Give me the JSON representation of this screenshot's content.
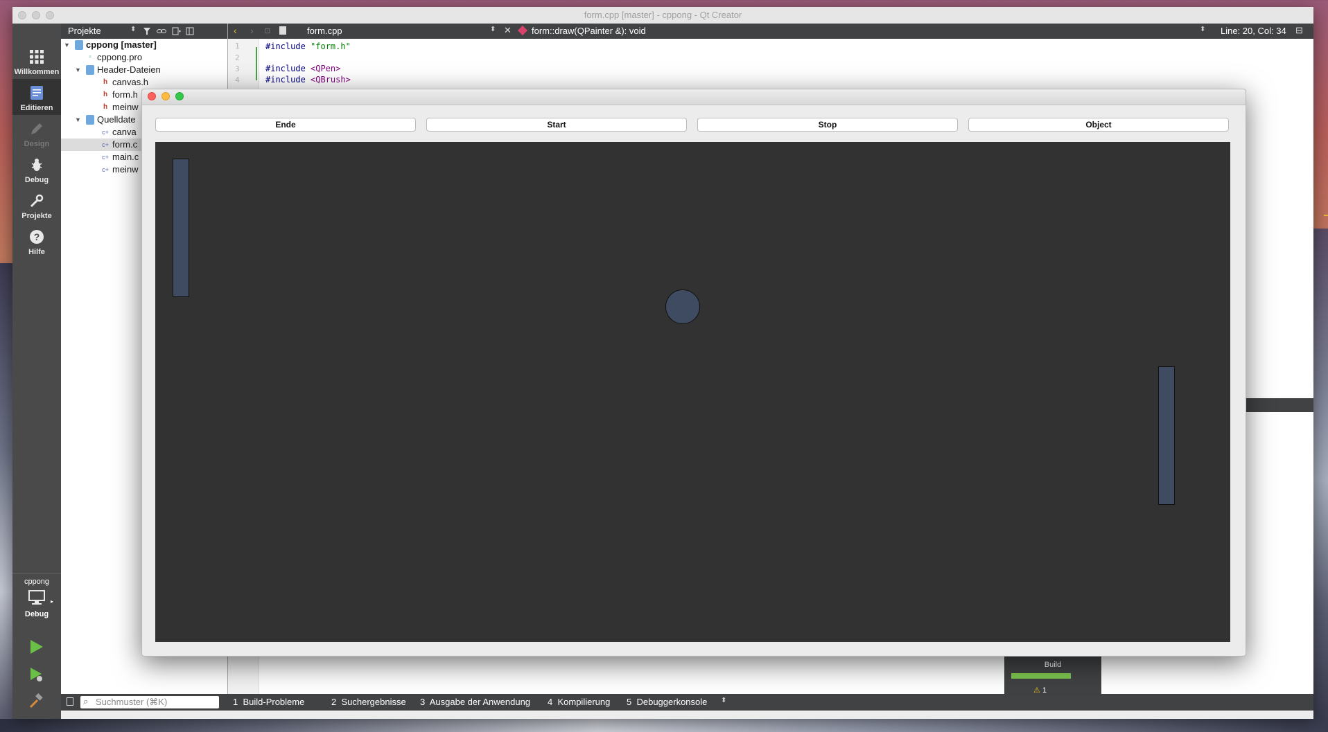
{
  "qt_window": {
    "title": "form.cpp [master] - cppong - Qt Creator"
  },
  "mode_bar": {
    "items": [
      {
        "label": "Willkommen",
        "icon": "grid-icon"
      },
      {
        "label": "Editieren",
        "icon": "edit-icon"
      },
      {
        "label": "Design",
        "icon": "pencil-icon"
      },
      {
        "label": "Debug",
        "icon": "bug-icon"
      },
      {
        "label": "Projekte",
        "icon": "wrench-icon"
      },
      {
        "label": "Hilfe",
        "icon": "help-icon"
      }
    ],
    "kit_project": "cppong",
    "kit_config": "Debug"
  },
  "project_panel": {
    "header": "Projekte",
    "tree": [
      {
        "label": "cppong [master]",
        "level": 0,
        "kind": "project"
      },
      {
        "label": "cppong.pro",
        "level": 1,
        "kind": "pro"
      },
      {
        "label": "Header-Dateien",
        "level": 1,
        "kind": "folder"
      },
      {
        "label": "canvas.h",
        "level": 2,
        "kind": "header"
      },
      {
        "label": "form.h",
        "level": 2,
        "kind": "header"
      },
      {
        "label": "meinw",
        "level": 2,
        "kind": "header"
      },
      {
        "label": "Quelldate",
        "level": 1,
        "kind": "folder"
      },
      {
        "label": "canva",
        "level": 2,
        "kind": "source"
      },
      {
        "label": "form.c",
        "level": 2,
        "kind": "source"
      },
      {
        "label": "main.c",
        "level": 2,
        "kind": "source"
      },
      {
        "label": "meinw",
        "level": 2,
        "kind": "source"
      }
    ]
  },
  "editor": {
    "file_name": "form.cpp",
    "function": "form::draw(QPainter &): void",
    "cursor_position": "Line: 20, Col: 34",
    "lines": [
      {
        "num": "1",
        "pre": "#include ",
        "str": "\"form.h\""
      },
      {
        "num": "2",
        "pre": "",
        "str": ""
      },
      {
        "num": "3",
        "pre": "#include ",
        "str": "<QPen>"
      },
      {
        "num": "4",
        "pre": "#include ",
        "str": "<QBrush>"
      }
    ]
  },
  "bottom_bar": {
    "search_placeholder": "Suchmuster (⌘K)",
    "tabs": [
      {
        "num": "1",
        "label": "Build-Probleme"
      },
      {
        "num": "2",
        "label": "Suchergebnisse"
      },
      {
        "num": "3",
        "label": "Ausgabe der Anwendung"
      },
      {
        "num": "4",
        "label": "Kompilierung"
      },
      {
        "num": "5",
        "label": "Debuggerkonsole"
      }
    ]
  },
  "build_status": {
    "label": "Build",
    "warnings": "1",
    "progress_fraction": 1.0,
    "color": "#7ec850"
  },
  "app_window": {
    "buttons": [
      {
        "label": "Ende"
      },
      {
        "label": "Start"
      },
      {
        "label": "Stop"
      },
      {
        "label": "Object"
      }
    ],
    "canvas_color": "#323232",
    "object_color": "#3f4b60"
  }
}
